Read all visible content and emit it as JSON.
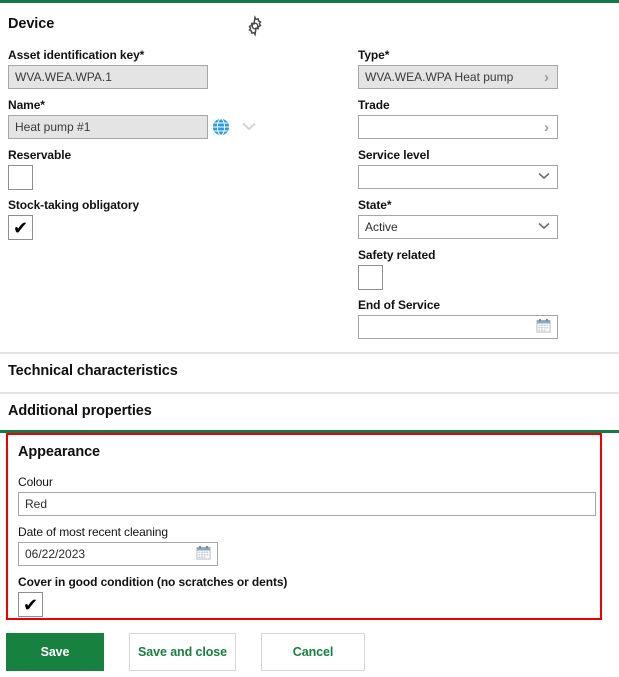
{
  "device": {
    "section_title": "Device",
    "gear_icon": "gear-icon",
    "asset_key": {
      "label": "Asset identification key",
      "required": true,
      "value": "WVA.WEA.WPA.1",
      "readonly": true
    },
    "name": {
      "label": "Name",
      "required": true,
      "value": "Heat pump #1",
      "readonly": true,
      "globe_icon": "globe-icon",
      "chevron_icon": "chevron-down-icon"
    },
    "reservable": {
      "label": "Reservable",
      "checked": false,
      "mark": ""
    },
    "stock_taking": {
      "label": "Stock-taking obligatory",
      "checked": true,
      "mark": "✔"
    },
    "type": {
      "label": "Type",
      "required": true,
      "value": "WVA.WEA.WPA Heat pump",
      "readonly": true,
      "chevron": "›"
    },
    "trade": {
      "label": "Trade",
      "required": false,
      "value": "",
      "readonly": false,
      "chevron": "›"
    },
    "service_level": {
      "label": "Service level",
      "required": false,
      "value": "",
      "readonly": false
    },
    "state": {
      "label": "State",
      "required": true,
      "value": "Active",
      "readonly": false
    },
    "safety_related": {
      "label": "Safety related",
      "checked": false,
      "mark": ""
    },
    "end_of_service": {
      "label": "End of Service",
      "required": false,
      "value": "",
      "calendar_icon": "calendar-icon"
    }
  },
  "technical": {
    "section_title": "Technical characteristics"
  },
  "additional": {
    "section_title": "Additional properties"
  },
  "appearance": {
    "section_title": "Appearance",
    "colour": {
      "label": "Colour",
      "value": "Red"
    },
    "cleaning_date": {
      "label": "Date of most recent cleaning",
      "value": "06/22/2023",
      "calendar_icon": "calendar-icon"
    },
    "cover_condition": {
      "label": "Cover in good condition (no scratches or dents)",
      "checked": true,
      "mark": "✔"
    }
  },
  "buttons": {
    "save": "Save",
    "save_and_close": "Save and close",
    "cancel": "Cancel"
  },
  "colors": {
    "brand_green": "#127a46",
    "button_green": "#17813f",
    "highlight_red": "#ee0000",
    "readonly_grey": "#e4e4e4",
    "border_grey": "#a6a6a6"
  },
  "required_marker": "*"
}
